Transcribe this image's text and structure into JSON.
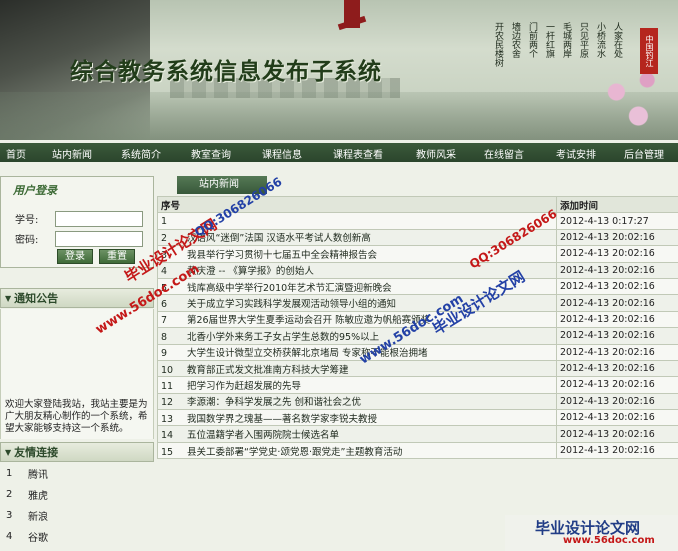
{
  "banner": {
    "title": "综合教务系统信息发布子系统",
    "poem_lines": [
      "人家在处",
      "小桥流水",
      "只见平原",
      "毛城两岸",
      "一杆红旗",
      "门前两个",
      "墙边农舍",
      "开农民楼树"
    ],
    "seal": "中国钓江"
  },
  "nav": {
    "items": [
      "首页",
      "站内新闻",
      "系统简介",
      "教室查询",
      "课程信息",
      "课程表查看",
      "教师风采",
      "在线留言",
      "考试安排",
      "后台管理"
    ]
  },
  "login": {
    "heading": "用户登录",
    "student_id_label": "学号:",
    "password_label": "密码:",
    "login_button": "登录",
    "reset_button": "重置"
  },
  "notice": {
    "heading": "通知公告",
    "text": "欢迎大家登陆我站，我站主要是为广大朋友精心制作的一个系统，希望大家能够支持这一个系统。"
  },
  "links": {
    "heading": "友情连接",
    "items": [
      {
        "num": "1",
        "name": "腾讯"
      },
      {
        "num": "2",
        "name": "雅虎"
      },
      {
        "num": "3",
        "name": "新浪"
      },
      {
        "num": "4",
        "name": "谷歌"
      }
    ]
  },
  "news": {
    "tab_label": "站内新闻",
    "col_no": "序号",
    "col_time": "添加时间",
    "rows": [
      {
        "no": "1",
        "title": "",
        "time": "2012-4-13  0:17:27"
      },
      {
        "no": "2",
        "title": "汉语风“迷倒”法国 汉语水平考试人数创新高",
        "time": "2012-4-13  20:02:16"
      },
      {
        "no": "3",
        "title": "我县举行学习贯彻十七届五中全会精神报告会",
        "time": "2012-4-13  20:02:16"
      },
      {
        "no": "4",
        "title": "黄庆澄 -- 《算学报》的创始人",
        "time": "2012-4-13  20:02:16"
      },
      {
        "no": "5",
        "title": "钱库高级中学举行2010年艺术节汇演暨迎新晚会",
        "time": "2012-4-13  20:02:16"
      },
      {
        "no": "6",
        "title": "关于成立学习实践科学发展观活动领导小组的通知",
        "time": "2012-4-13  20:02:16"
      },
      {
        "no": "7",
        "title": "第26届世界大学生夏季运动会召开 陈敏应邀为帆船赛颁奖",
        "time": "2012-4-13  20:02:16"
      },
      {
        "no": "8",
        "title": "北香小学外来务工子女占学生总数的95%以上",
        "time": "2012-4-13  20:02:16"
      },
      {
        "no": "9",
        "title": "大学生设计微型立交桥获解北京堵局 专家称不能根治拥堵",
        "time": "2012-4-13  20:02:16"
      },
      {
        "no": "10",
        "title": "教育部正式发文批准南方科技大学筹建",
        "time": "2012-4-13  20:02:16"
      },
      {
        "no": "11",
        "title": "把学习作为赶超发展的先导",
        "time": "2012-4-13  20:02:16"
      },
      {
        "no": "12",
        "title": "李源潮：争科学发展之先 创和谐社会之优",
        "time": "2012-4-13  20:02:16"
      },
      {
        "no": "13",
        "title": "我国数学界之瑰基——著名数学家李锐夫教授",
        "time": "2012-4-13  20:02:16"
      },
      {
        "no": "14",
        "title": "五位温籍学者入围两院院士候选名单",
        "time": "2012-4-13  20:02:16"
      },
      {
        "no": "15",
        "title": "县关工委部署“学党史·颂党恩·跟党走”主题教育活动",
        "time": "2012-4-13  20:02:16"
      }
    ]
  },
  "watermarks": {
    "wm1": "毕业设计论文网",
    "wm2": "QQ:306826066",
    "wm3": "www.56doc.com",
    "wm4": "QQ:306826066",
    "wm5": "www.56doc.com",
    "wm6": "毕业设计论文网",
    "corner_big": "毕业设计论文网",
    "corner_small": "www.56doc.com"
  },
  "colors": {
    "nav_bg": "#2b452c",
    "panel_title": "#2d4a2b",
    "watermark_red": "#c41818",
    "watermark_blue": "#2341a6"
  }
}
